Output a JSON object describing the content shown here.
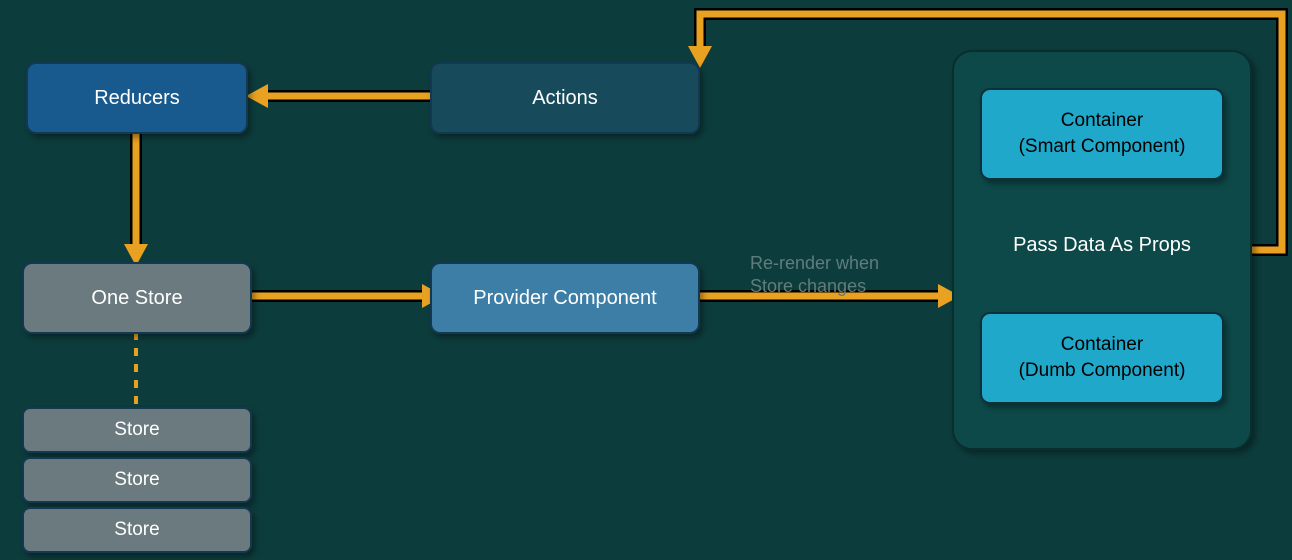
{
  "nodes": {
    "reducers": "Reducers",
    "actions": "Actions",
    "one_store": "One Store",
    "provider": "Provider Component",
    "store_a": "Store",
    "store_b": "Store",
    "store_c": "Store",
    "smart_line1": "Container",
    "smart_line2": "(Smart Component)",
    "dumb_line1": "Container",
    "dumb_line2": "(Dumb Component)"
  },
  "labels": {
    "props": "Pass Data As Props",
    "rerender_line1": "Re-render when",
    "rerender_line2": "Store changes"
  },
  "colors": {
    "arrow": "#e8a120",
    "bg": "#0d3c3c",
    "panel": "#0e4949"
  }
}
